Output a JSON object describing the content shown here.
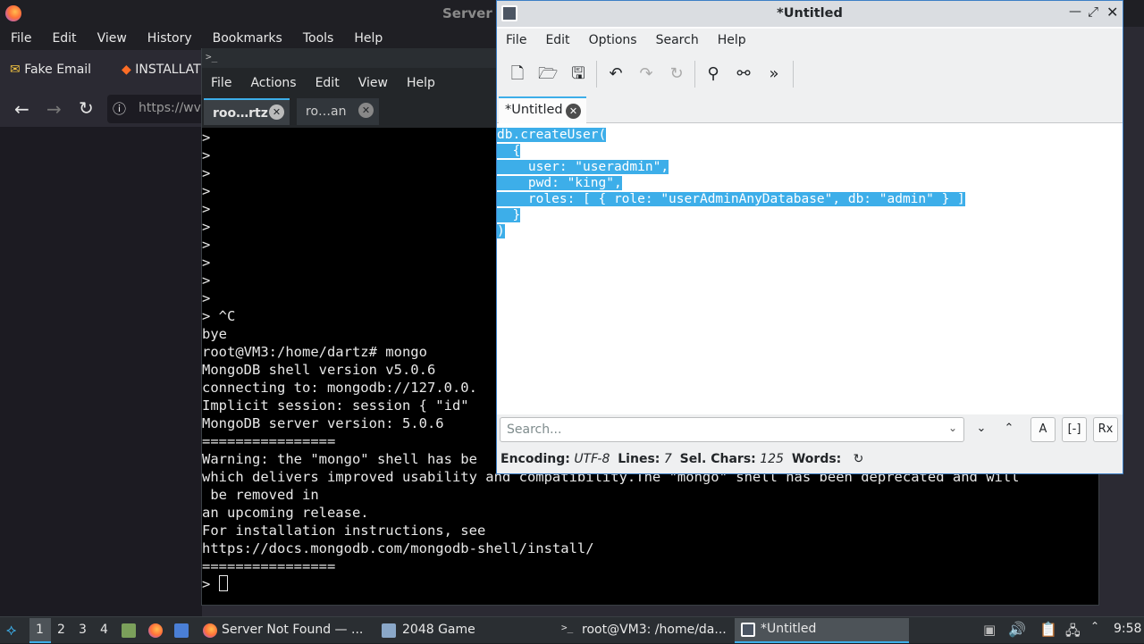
{
  "firefox": {
    "title": "Server",
    "menu": [
      "File",
      "Edit",
      "View",
      "History",
      "Bookmarks",
      "Tools",
      "Help"
    ],
    "bookmarks": [
      {
        "label": "Fake Email",
        "icon": "envelope-icon"
      },
      {
        "label": "INSTALLAT",
        "icon": "gitlab-icon"
      }
    ],
    "url": "https://wv"
  },
  "terminal": {
    "menu": [
      "File",
      "Actions",
      "Edit",
      "View",
      "Help"
    ],
    "tabs": [
      {
        "label": "roo…rtz",
        "active": true
      },
      {
        "label": "ro…an",
        "active": false
      }
    ],
    "lines": [
      ">",
      ">",
      ">",
      ">",
      ">",
      ">",
      ">",
      ">",
      ">",
      ">",
      "> ^C",
      "bye",
      "root@VM3:/home/dartz# mongo",
      "MongoDB shell version v5.0.6",
      "connecting to: mongodb://127.0.0.",
      "Implicit session: session { \"id\"",
      "MongoDB server version: 5.0.6",
      "================",
      "Warning: the \"mongo\" shell has be",
      "which delivers improved usability and compatibility.The \"mongo\" shell has been deprecated and will",
      " be removed in",
      "an upcoming release.",
      "For installation instructions, see",
      "https://docs.mongodb.com/mongodb-shell/install/",
      "================"
    ],
    "prompt": "> "
  },
  "kate": {
    "title": "*Untitled",
    "menu": [
      "File",
      "Edit",
      "Options",
      "Search",
      "Help"
    ],
    "tab_label": "*Untitled",
    "code_lines": [
      "db.createUser(",
      "  {",
      "    user: \"useradmin\",",
      "    pwd: \"king\",",
      "    roles: [ { role: \"userAdminAnyDatabase\", db: \"admin\" } ]",
      "  }",
      ")"
    ],
    "search_placeholder": "Search...",
    "status": {
      "encoding_label": "Encoding:",
      "encoding": "UTF-8",
      "lines_label": "Lines:",
      "lines": "7",
      "selchars_label": "Sel. Chars:",
      "selchars": "125",
      "words_label": "Words:"
    }
  },
  "taskbar": {
    "workspaces": [
      "1",
      "2",
      "3",
      "4"
    ],
    "tasks": [
      {
        "label": "Server Not Found — ...",
        "icon": "firefox-icon"
      },
      {
        "label": "2048 Game",
        "icon": "window-icon"
      },
      {
        "label": "root@VM3: /home/da...",
        "icon": "terminal-icon"
      },
      {
        "label": "*Untitled",
        "icon": "kate-icon"
      }
    ],
    "clock": "9:58"
  }
}
